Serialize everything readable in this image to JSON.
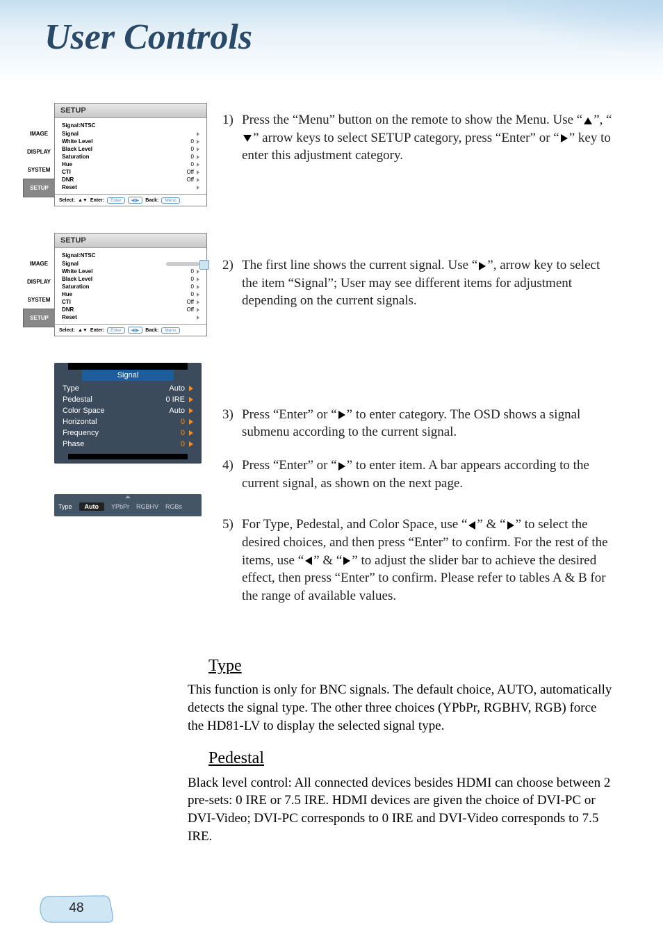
{
  "page": {
    "title": "User Controls",
    "number": "48"
  },
  "osd": {
    "title": "SETUP",
    "signal_line": "Signal:NTSC",
    "tabs": [
      "IMAGE",
      "DISPLAY",
      "SYSTEM",
      "SETUP"
    ],
    "rows": [
      {
        "label": "Signal",
        "value": ""
      },
      {
        "label": "White Level",
        "value": "0"
      },
      {
        "label": "Black Level",
        "value": "0"
      },
      {
        "label": "Saturation",
        "value": "0"
      },
      {
        "label": "Hue",
        "value": "0"
      },
      {
        "label": "CTI",
        "value": "Off"
      },
      {
        "label": "DNR",
        "value": "Off"
      },
      {
        "label": "Reset",
        "value": ""
      }
    ],
    "footer": {
      "select": "Select:",
      "enter": "Enter:",
      "enter_chip": "Enter",
      "back": "Back:",
      "menu_chip": "Menu"
    }
  },
  "signal_menu": {
    "title": "Signal",
    "rows": [
      {
        "label": "Type",
        "value": "Auto"
      },
      {
        "label": "Pedestal",
        "value": "0 IRE"
      },
      {
        "label": "Color Space",
        "value": "Auto"
      },
      {
        "label": "Horizontal",
        "value": "0"
      },
      {
        "label": "Frequency",
        "value": "0"
      },
      {
        "label": "Phase",
        "value": "0"
      }
    ]
  },
  "type_strip": {
    "label": "Type",
    "options": [
      "Auto",
      "YPbPr",
      "RGBHV",
      "RGBs"
    ],
    "selected": "Auto"
  },
  "steps": {
    "s1": "Press the “Menu” button on the remote to show the Menu. Use “",
    "s1b": "”, “",
    "s1c": "” arrow keys to select SETUP category, press “Enter” or “",
    "s1d": "” key to enter this adjustment category.",
    "s2": "The first line shows the current signal. Use “",
    "s2b": "”, arrow key to select the item “Signal”; User may see different items for adjustment depending on the current signals.",
    "s3": "Press “Enter” or “",
    "s3b": "” to enter category. The OSD shows a signal submenu according to the current signal.",
    "s4": "Press “Enter” or “",
    "s4b": "” to enter item. A bar appears according to the current signal, as shown on the next page.",
    "s5": "For Type, Pedestal, and Color Space, use “",
    "s5b": "” & “",
    "s5c": "” to select the desired choices, and then press “Enter” to confirm. For the rest of the items, use “",
    "s5d": "” & “",
    "s5e": "” to adjust the slider bar to achieve the desired effect, then press “Enter” to confirm. Please refer to tables A & B for the range of available values.",
    "n1": "1)",
    "n2": "2)",
    "n3": "3)",
    "n4": "4)",
    "n5": "5)"
  },
  "sections": {
    "type_h": "Type",
    "type_b": "This function is only for BNC signals. The default choice, AUTO, automatically detects the signal type. The other three choices (YPbPr, RGBHV, RGB) force the HD81-LV to display the selected signal type.",
    "ped_h": "Pedestal",
    "ped_b": "Black level control: All connected devices besides HDMI can choose between 2 pre-sets: 0 IRE or 7.5 IRE. HDMI devices are given the choice of DVI-PC or DVI-Video; DVI-PC corresponds to 0 IRE and DVI-Video corresponds to 7.5 IRE."
  }
}
